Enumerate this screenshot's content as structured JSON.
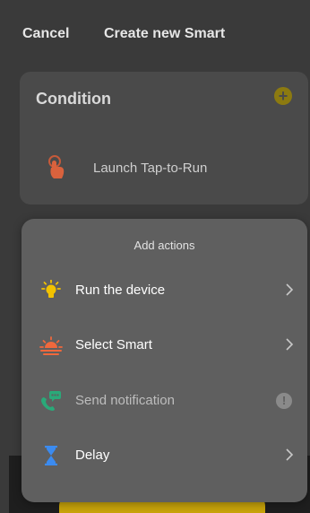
{
  "header": {
    "cancel_label": "Cancel",
    "title": "Create new Smart"
  },
  "condition": {
    "title": "Condition",
    "add_icon": "plus-circle-icon",
    "item": {
      "icon": "tap-hand-icon",
      "label": "Launch Tap-to-Run"
    }
  },
  "actions_sheet": {
    "title": "Add actions",
    "items": [
      {
        "label": "Run the device",
        "icon": "lightbulb-icon",
        "trailing": "chevron-right-icon",
        "enabled": true
      },
      {
        "label": "Select Smart",
        "icon": "sunset-icon",
        "trailing": "chevron-right-icon",
        "enabled": true
      },
      {
        "label": "Send notification",
        "icon": "chat-phone-icon",
        "trailing": "info-icon",
        "trailing_text": "!",
        "enabled": false
      },
      {
        "label": "Delay",
        "icon": "hourglass-icon",
        "trailing": "chevron-right-icon",
        "enabled": true
      }
    ]
  },
  "colors": {
    "background": "#3a3a3a",
    "card": "#4a4a4a",
    "sheet": "#5f5f5f",
    "accent_yellow": "#f2c200",
    "accent_orange": "#f0683c",
    "accent_green": "#2aa979",
    "accent_blue": "#3b8bf0"
  }
}
